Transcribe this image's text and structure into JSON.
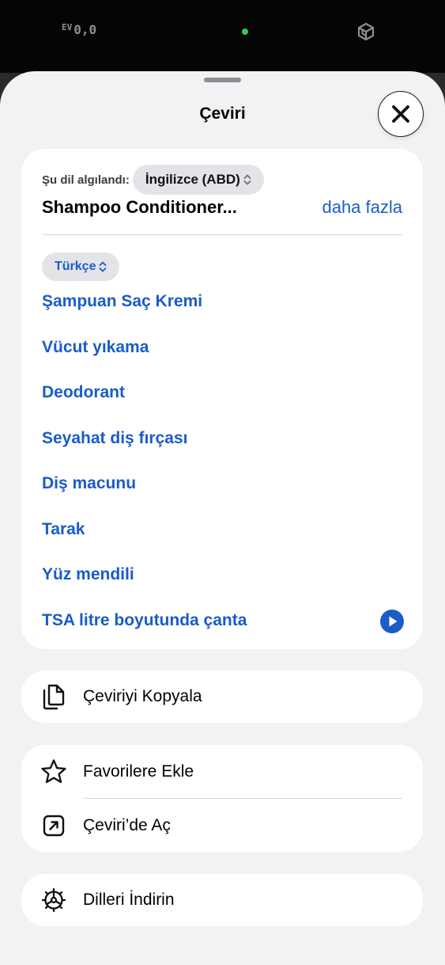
{
  "camera": {
    "ev_label": "EV",
    "ev_value": "0,0",
    "indicator_color": "#35c759"
  },
  "sheet": {
    "title": "Çeviri",
    "close_icon": "close-icon"
  },
  "detection": {
    "label": "Şu dil algılandı:",
    "source_language": "İngilizce (ABD)",
    "source_text": "Shampoo Conditioner...",
    "more_label": "daha fazla"
  },
  "translation": {
    "target_language": "Türkçe",
    "lines": [
      "Şampuan Saç Kremi",
      "Vücut yıkama",
      "Deodorant",
      "Seyahat diş fırçası",
      "Diş macunu",
      "Tarak",
      "Yüz mendili",
      "TSA litre boyutunda çanta"
    ],
    "play_icon": "play-icon",
    "accent_color": "#1a5cc8"
  },
  "actions": {
    "copy_label": "Çeviriyi Kopyala",
    "favorite_label": "Favorilere Ekle",
    "open_label": "Çeviri’de Aç",
    "download_label": "Dilleri İndirin"
  }
}
